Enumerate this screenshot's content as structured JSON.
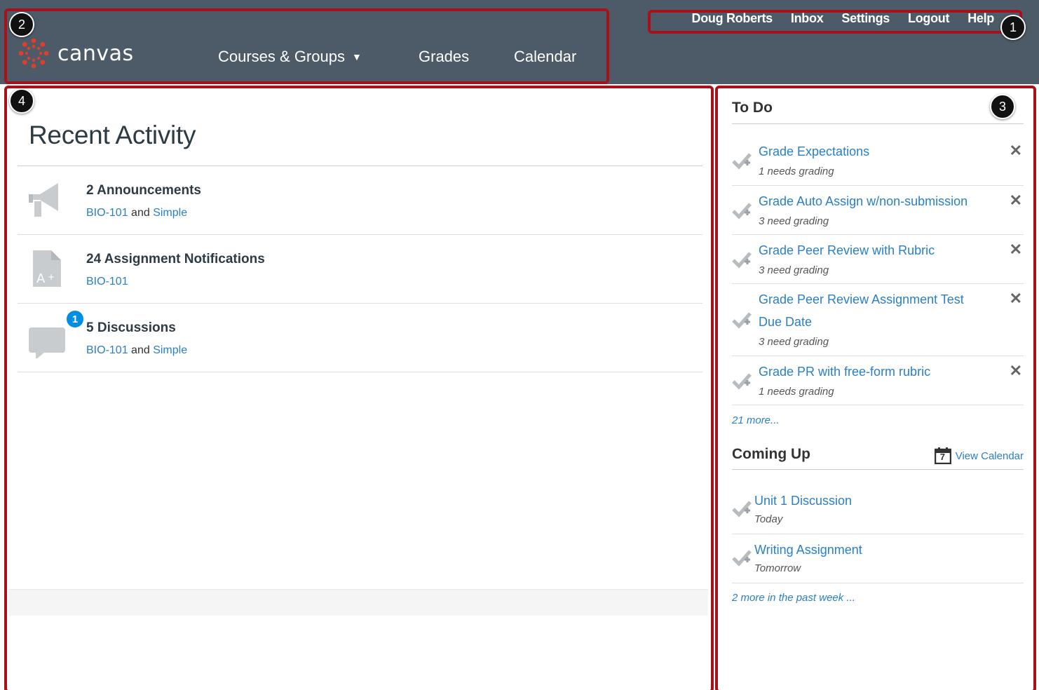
{
  "header": {
    "logo_text": "canvas",
    "nav": {
      "courses": "Courses & Groups",
      "grades": "Grades",
      "calendar": "Calendar"
    },
    "user_links": [
      "Doug Roberts",
      "Inbox",
      "Settings",
      "Logout",
      "Help"
    ]
  },
  "markers": [
    "1",
    "2",
    "3",
    "4"
  ],
  "main": {
    "title": "Recent Activity",
    "items": [
      {
        "title": "2 Announcements",
        "course": "BIO-101",
        "joiner": "and",
        "course2": "Simple",
        "icon": "megaphone-icon"
      },
      {
        "title": "24 Assignment Notifications",
        "course": "BIO-101",
        "icon": "assignment-icon"
      },
      {
        "title": "5 Discussions",
        "course": "BIO-101",
        "joiner": "and",
        "course2": "Simple",
        "icon": "discussion-icon",
        "badge": "1"
      }
    ]
  },
  "sidebar": {
    "todo_title": "To Do",
    "todo": [
      {
        "title": "Grade Expectations",
        "sub": "1 needs grading"
      },
      {
        "title": "Grade Auto Assign w/non-submission",
        "sub": "3 need grading"
      },
      {
        "title": "Grade Peer Review with Rubric",
        "sub": "3 need grading"
      },
      {
        "title": "Grade Peer Review Assignment Test Due Date",
        "sub": "3 need grading"
      },
      {
        "title": "Grade PR with free-form rubric",
        "sub": "1 needs grading"
      }
    ],
    "todo_more": "21 more...",
    "coming_title": "Coming Up",
    "view_calendar": "View Calendar",
    "calendar_day": "7",
    "coming": [
      {
        "title": "Unit 1 Discussion",
        "sub": "Today"
      },
      {
        "title": "Writing Assignment",
        "sub": "Tomorrow"
      }
    ],
    "coming_more": "2 more in the past week ..."
  },
  "colors": {
    "header_bg": "#4d5a68",
    "link": "#2980c8",
    "callout": "#a8111a",
    "badge": "#008ee2",
    "logo": "#e03e2d"
  }
}
